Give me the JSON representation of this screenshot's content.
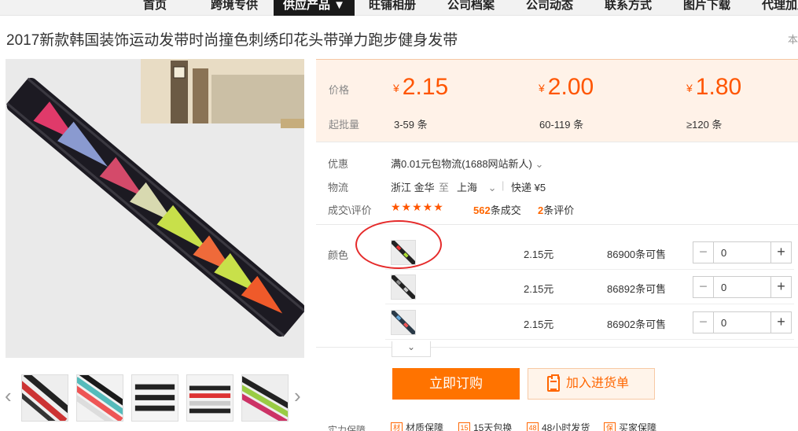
{
  "nav": {
    "items": [
      "首页",
      "跨境专供",
      "供应产品 ▼",
      "旺铺相册",
      "公司档案",
      "公司动态",
      "联系方式",
      "图片下载",
      "代理加盟"
    ]
  },
  "product": {
    "title": "2017新款韩国装饰运动发带时尚撞色刺绣印花头带弹力跑步健身发带",
    "title_extra": "本"
  },
  "price_box": {
    "price_label": "价格",
    "batch_label": "起批量",
    "currency": "¥",
    "tiers": [
      {
        "price": "2.15",
        "range": "3-59 条"
      },
      {
        "price": "2.00",
        "range": "60-119 条"
      },
      {
        "price": "1.80",
        "range": "≥120 条"
      }
    ]
  },
  "info": {
    "promo_label": "优惠",
    "promo_text": "满0.01元包物流(1688网站新人)",
    "logistics_label": "物流",
    "origin": "浙江 金华",
    "to": "至",
    "destination": "上海",
    "express": "快递 ¥5",
    "deal_label": "成交\\评价",
    "stars": "★★★★★",
    "deals_count": "562",
    "deals_suffix": "条成交",
    "reviews_count": "2",
    "reviews_suffix": "条评价"
  },
  "variants": {
    "label": "颜色",
    "items": [
      {
        "price": "2.15元",
        "stock": "86900条可售",
        "qty": "0"
      },
      {
        "price": "2.15元",
        "stock": "86892条可售",
        "qty": "0"
      },
      {
        "price": "2.15元",
        "stock": "86902条可售",
        "qty": "0"
      }
    ],
    "more_toggle": "⌄"
  },
  "actions": {
    "buy_now": "立即订购",
    "add_to_cart": "加入进货单"
  },
  "guarantee": {
    "label": "实力保障",
    "items": [
      {
        "icon": "材",
        "text": "材质保障"
      },
      {
        "icon": "15",
        "text": "15天包换"
      },
      {
        "icon": "48",
        "text": "48小时发货"
      },
      {
        "icon": "保",
        "text": "买家保障"
      }
    ]
  },
  "colors": {
    "accent": "#ff5500",
    "buy_button": "#ff7300",
    "price_bg": "#fff2e8",
    "annotation": "#e52b2b"
  }
}
